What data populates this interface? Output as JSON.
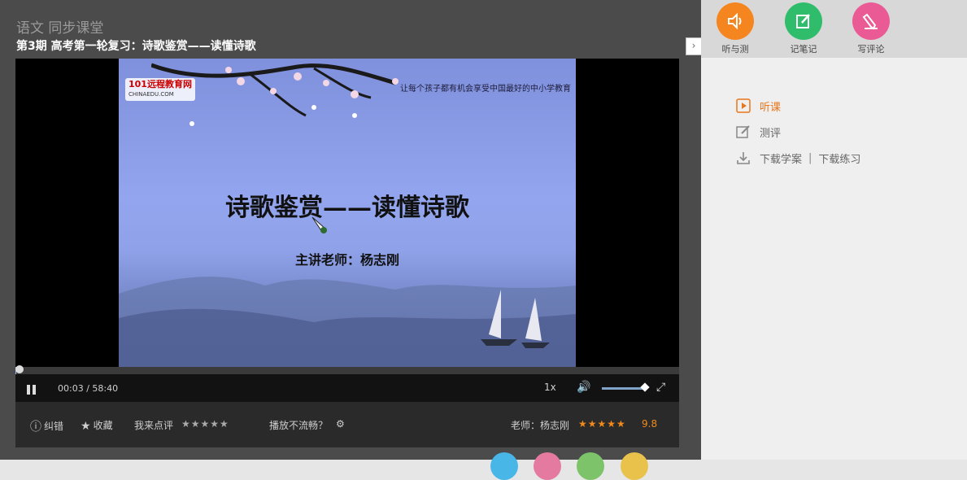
{
  "header": {
    "breadcrumb": "语文 同步课堂",
    "title": "第3期 高考第一轮复习：诗歌鉴赏——读懂诗歌"
  },
  "slide": {
    "logo_text": "101远程教育网",
    "logo_sub": "CHINAEDU.COM",
    "slogan": "让每个孩子都有机会享受中国最好的中小学教育",
    "title": "诗歌鉴赏——读懂诗歌",
    "teacher_line": "主讲老师：杨志刚"
  },
  "player": {
    "current_time": "00:03",
    "separator": "/",
    "duration": "58:40",
    "speed": "1x",
    "progress_fraction": 0.001,
    "volume_fraction": 0.9
  },
  "bottombar": {
    "report_label": "纠错",
    "favorite_label": "收藏",
    "rate_label": "我来点评",
    "rate_stars": "★★★★★",
    "playback_issue_label": "播放不流畅？",
    "teacher_label": "老师：杨志刚",
    "teacher_stars": "★★★★★",
    "score": "9.8"
  },
  "tools": [
    {
      "label": "听与测",
      "color": "#f5861f",
      "icon": "speaker-icon"
    },
    {
      "label": "记笔记",
      "color": "#2fbd6b",
      "icon": "note-edit-icon"
    },
    {
      "label": "写评论",
      "color": "#ea5a94",
      "icon": "pencil-icon"
    }
  ],
  "menu": {
    "listen": "听课",
    "test": "测评",
    "download_notes": "下载学案",
    "separator": "|",
    "download_practice": "下载练习"
  },
  "colors": {
    "accent": "#e8761a",
    "star": "#f08a1c"
  }
}
